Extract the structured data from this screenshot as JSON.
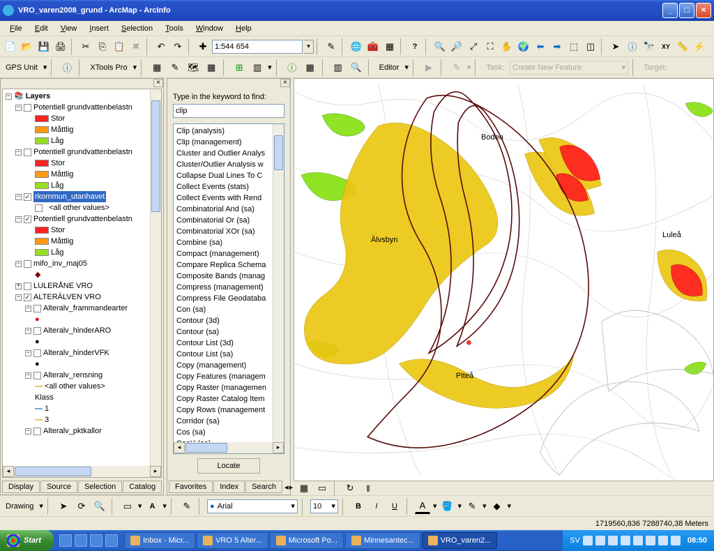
{
  "window": {
    "title": "VRO_varen2008_grund - ArcMap - ArcInfo"
  },
  "menu": {
    "items": [
      "File",
      "Edit",
      "View",
      "Insert",
      "Selection",
      "Tools",
      "Window",
      "Help"
    ]
  },
  "toolbar1": {
    "scale": "1:544 654"
  },
  "toolbar2": {
    "gps_label": "GPS Unit",
    "xtools_label": "XTools Pro",
    "editor_label": "Editor",
    "task_label": "Task:",
    "task_value": "Create New Feature",
    "target_label": "Target:"
  },
  "layers": {
    "title": "Layers",
    "pot1": {
      "name": "Potentiell grundvattenbelastn",
      "items": [
        "Stor",
        "Måttlig",
        "Låg"
      ]
    },
    "pot2": {
      "name": "Potentiell grundvattenbelastn",
      "items": [
        "Stor",
        "Måttlig",
        "Låg"
      ]
    },
    "selected": "rkommun_utanhavet",
    "all_other": "<all other values>",
    "pot3": {
      "name": "Potentiell grundvattenbelastn",
      "items": [
        "Stor",
        "Måttlig",
        "Låg"
      ]
    },
    "mifo": "mifo_inv_maj05",
    "lule": "LULERÅNE VRO",
    "alter": "ALTERÄLVEN VRO",
    "alter_sub": {
      "frammande": "Alteralv_frammandearter",
      "hinderARO": "Alteralv_hinderARO",
      "hinderVFK": "Alteralv_hinderVFK",
      "rensning": "Alteralv_rensning",
      "all_other": "<all other values>",
      "klass": "Klass",
      "k1": "1",
      "k3": "3",
      "pktkallor": "Alteralv_pktkallor"
    },
    "tabs": [
      "Display",
      "Source",
      "Selection",
      "Catalog"
    ]
  },
  "search": {
    "label": "Type in the keyword to find:",
    "input": "clip",
    "results": [
      "Clip (analysis)",
      "Clip (management)",
      "Cluster and Outlier Analys",
      "Cluster/Outlier Analysis w",
      "Collapse Dual Lines To C",
      "Collect Events (stats)",
      "Collect Events with Rend",
      "Combinatorial And (sa)",
      "Combinatorial Or (sa)",
      "Combinatorial XOr (sa)",
      "Combine (sa)",
      "Compact (management)",
      "Compare Replica Schema",
      "Composite Bands (manag",
      "Compress (management)",
      "Compress File Geodataba",
      "Con (sa)",
      "Contour (3d)",
      "Contour (sa)",
      "Contour List (3d)",
      "Contour List (sa)",
      "Copy (management)",
      "Copy Features (managem",
      "Copy Raster (managemen",
      "Copy Raster Catalog Item",
      "Copy Rows (management",
      "Corridor (sa)",
      "Cos (sa)",
      "CosH (sa)"
    ],
    "locate": "Locate",
    "tabs": [
      "Favorites",
      "Index",
      "Search"
    ]
  },
  "map": {
    "labels": {
      "boden": "Boden",
      "alvsbyn": "Älvsbyn",
      "pitea": "Piteå",
      "lulea": "Luleå"
    }
  },
  "drawing": {
    "label": "Drawing",
    "font": "Arial",
    "size": "10"
  },
  "status": {
    "coords": "1719560,836  7288740,38 Meters"
  },
  "taskbar": {
    "start": "Start",
    "tasks": [
      {
        "label": "Inbox - Micr..."
      },
      {
        "label": "VRO 5 Alter..."
      },
      {
        "label": "Microsoft Po..."
      },
      {
        "label": "Minnesantec..."
      },
      {
        "label": "VRO_varen2..."
      }
    ],
    "lang": "SV",
    "clock": "08:50"
  }
}
